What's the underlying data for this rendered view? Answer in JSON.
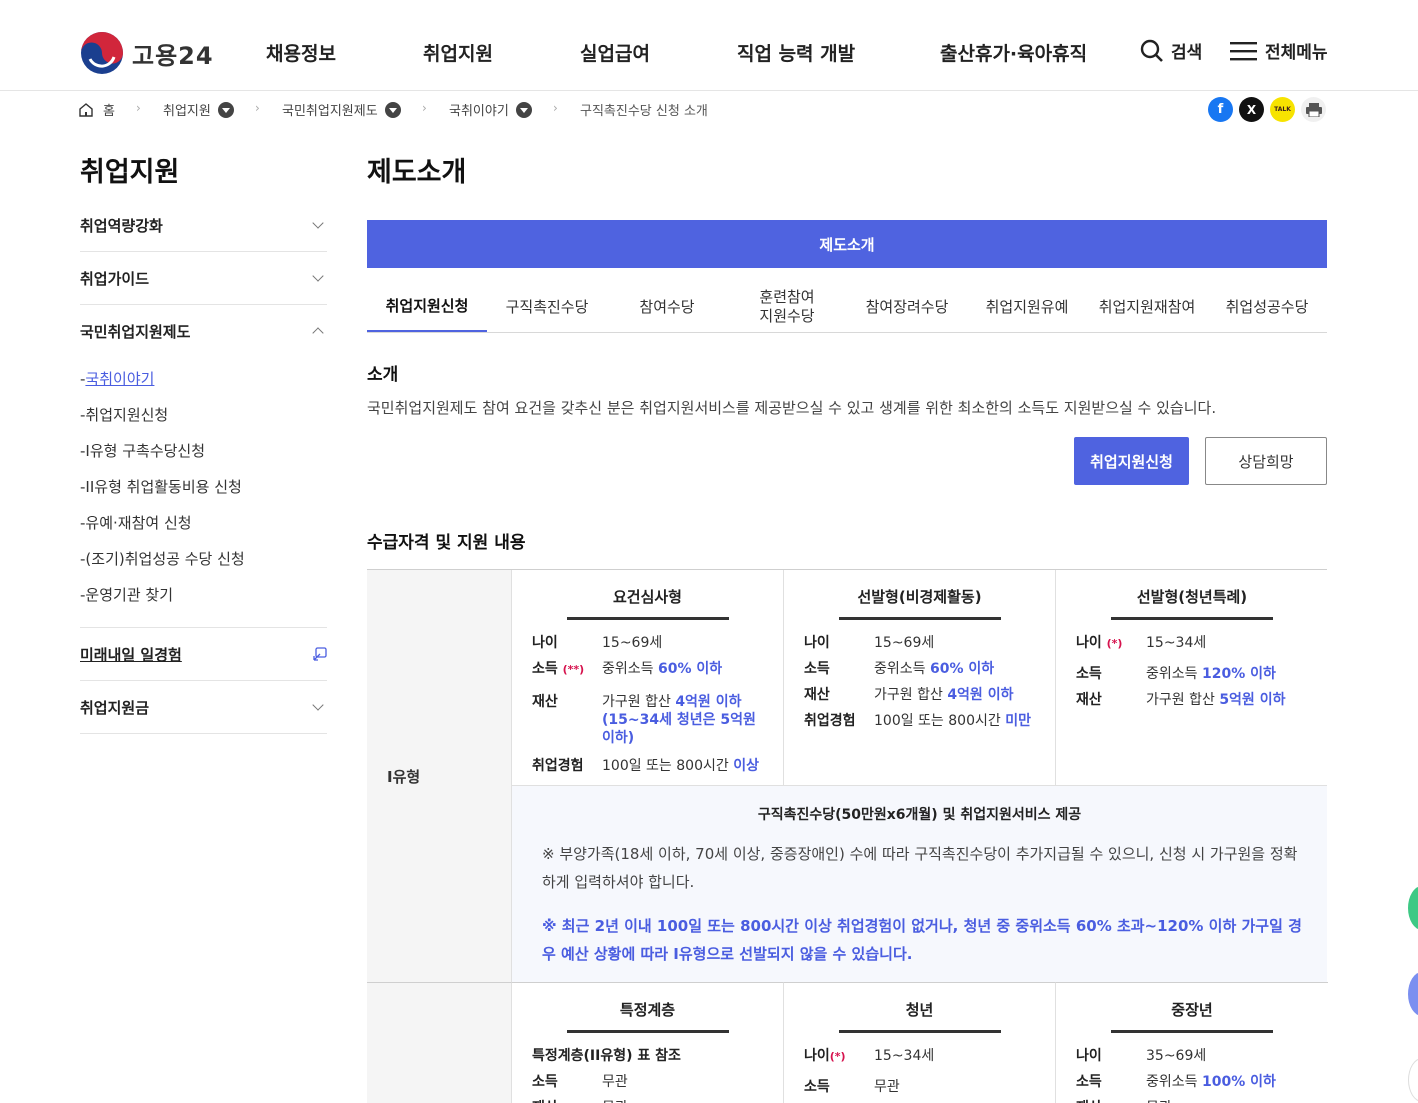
{
  "header": {
    "logo_text": "고용24",
    "nav": [
      "채용정보",
      "취업지원",
      "실업급여",
      "직업 능력 개발",
      "출산휴가·육아휴직"
    ],
    "search_label": "검색",
    "menu_label": "전체메뉴"
  },
  "breadcrumb": {
    "home": "홈",
    "items": [
      "취업지원",
      "국민취업지원제도",
      "국취이야기"
    ],
    "current": "구직촉진수당 신청 소개"
  },
  "share": {
    "facebook": "f",
    "x": "X",
    "kakao": "TALK"
  },
  "sidebar": {
    "title": "취업지원",
    "items": [
      {
        "label": "취업역량강화"
      },
      {
        "label": "취업가이드"
      },
      {
        "label": "국민취업지원제도"
      },
      {
        "label": "미래내일 일경험"
      },
      {
        "label": "취업지원금"
      }
    ],
    "sub_items": [
      "국취이야기",
      "취업지원신청",
      "I유형 구촉수당신청",
      "II유형 취업활동비용 신청",
      "유예·재참여 신청",
      "(조기)취업성공 수당 신청",
      "운영기관 찾기"
    ]
  },
  "main": {
    "title": "제도소개",
    "banner": "제도소개",
    "tabs": [
      "취업지원신청",
      "구직촉진수당",
      "참여수당",
      "훈련참여\n지원수당",
      "참여장려수당",
      "취업지원유예",
      "취업지원재참여",
      "취업성공수당"
    ],
    "intro_heading": "소개",
    "intro_text": "국민취업지원제도 참여 요건을 갖추신 분은 취업지원서비스를 제공받으실 수 있고 생계를 위한 최소한의 소득도 지원받으실 수 있습니다.",
    "apply_button": "취업지원신청",
    "consult_button": "상담희망",
    "eligibility_heading": "수급자격 및 지원 내용"
  },
  "table": {
    "type1_label": "I유형",
    "type1_cols": [
      {
        "header": "요건심사형",
        "rows": [
          {
            "k": "나이",
            "v": "15~69세"
          },
          {
            "k": "소득",
            "mark": "(**)",
            "v": "중위소득 ",
            "hl": "60% 이하"
          },
          {
            "k": "재산",
            "v": "가구원 합산 ",
            "hl": "4억원 이하 (15~34세 청년은 5억원 이하)"
          },
          {
            "k": "취업경험",
            "v": "100일 또는 800시간 ",
            "hl": "이상"
          }
        ]
      },
      {
        "header": "선발형(비경제활동)",
        "rows": [
          {
            "k": "나이",
            "v": "15~69세"
          },
          {
            "k": "소득",
            "v": "중위소득 ",
            "hl": "60% 이하"
          },
          {
            "k": "재산",
            "v": "가구원 합산 ",
            "hl": "4억원 이하"
          },
          {
            "k": "취업경험",
            "v": "100일 또는 800시간 ",
            "hl": "미만"
          }
        ]
      },
      {
        "header": "선발형(청년특례)",
        "rows": [
          {
            "k": "나이",
            "mark": "(*)",
            "v": "15~34세"
          },
          {
            "k": "소득",
            "v": "중위소득 ",
            "hl": "120% 이하"
          },
          {
            "k": "재산",
            "v": "가구원 합산 ",
            "hl": "5억원 이하"
          }
        ]
      }
    ],
    "type1_support_title": "구직촉진수당(50만원x6개월) 및 취업지원서비스 제공",
    "type1_note1": "※ 부양가족(18세 이하, 70세 이상, 중증장애인) 수에 따라 구직촉진수당이 추가지급될 수 있으니, 신청 시 가구원을 정확하게 입력하셔야 합니다.",
    "type1_note2": "※ 최근 2년 이내 100일 또는 800시간 이상 취업경험이 없거나, 청년 중 중위소득 60% 초과~120% 이하 가구일 경우 예산 상황에 따라 I유형으로 선발되지 않을 수 있습니다.",
    "type2_cols": [
      {
        "header": "특정계층",
        "rows": [
          {
            "k": "특정계층(II유형) 표 참조",
            "v": ""
          },
          {
            "k": "소득",
            "v": "무관"
          },
          {
            "k": "재산",
            "v": "무관"
          }
        ]
      },
      {
        "header": "청년",
        "rows": [
          {
            "k": "나이",
            "mark": "(*)",
            "v": "15~34세"
          },
          {
            "k": "소득",
            "v": "무관"
          }
        ]
      },
      {
        "header": "중장년",
        "rows": [
          {
            "k": "나이",
            "v": "35~69세"
          },
          {
            "k": "소득",
            "v": "중위소득 ",
            "hl": "100% 이하"
          },
          {
            "k": "재산",
            "v": "무관"
          }
        ]
      }
    ]
  },
  "colors": {
    "accent": "#4f63e0",
    "highlight": "#4a5de0",
    "mark": "#d6134e"
  }
}
